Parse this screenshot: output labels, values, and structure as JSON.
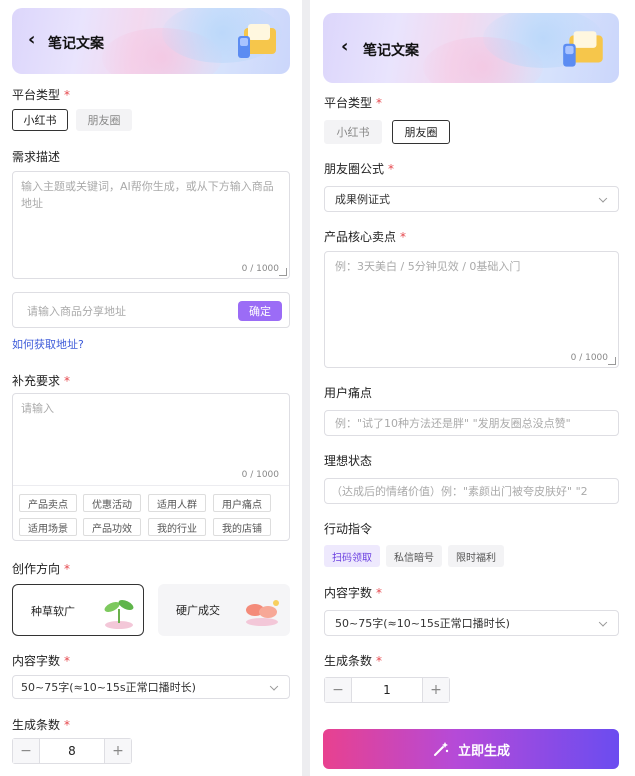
{
  "left": {
    "header": {
      "back_icon": "chevron-left-icon",
      "title": "笔记文案"
    },
    "platform": {
      "label": "平台类型",
      "required": "*",
      "options": [
        "小红书",
        "朋友圈"
      ],
      "selected": "小红书"
    },
    "need": {
      "label": "需求描述",
      "placeholder": "输入主题或关键词，AI帮你生成，或从下方输入商品地址",
      "counter": "0 / 1000"
    },
    "url": {
      "placeholder": "请输入商品分享地址",
      "confirm": "确定",
      "help_link": "如何获取地址?"
    },
    "extra": {
      "label": "补充要求",
      "required": "*",
      "placeholder": "请输入",
      "counter": "0 / 1000",
      "tags": [
        "产品卖点",
        "优惠活动",
        "适用人群",
        "用户痛点",
        "适用场景",
        "产品功效",
        "我的行业",
        "我的店铺"
      ]
    },
    "direction": {
      "label": "创作方向",
      "required": "*",
      "cards": [
        "种草软广",
        "硬广成交"
      ],
      "selected": "种草软广"
    },
    "word_count": {
      "label": "内容字数",
      "required": "*",
      "value": "50~75字(≈10~15s正常口播时长)"
    },
    "gen_count": {
      "label": "生成条数",
      "required": "*",
      "minus": "−",
      "value": "8",
      "plus": "+"
    }
  },
  "right": {
    "header": {
      "back_icon": "chevron-left-icon",
      "title": "笔记文案"
    },
    "platform": {
      "label": "平台类型",
      "required": "*",
      "options": [
        "小红书",
        "朋友圈"
      ],
      "selected": "朋友圈"
    },
    "formula": {
      "label": "朋友圈公式",
      "required": "*",
      "value": "成果例证式"
    },
    "selling": {
      "label": "产品核心卖点",
      "required": "*",
      "placeholder": "例：3天美白 / 5分钟见效 / 0基础入门",
      "counter": "0 / 1000"
    },
    "pain": {
      "label": "用户痛点",
      "placeholder": "例：\"试了10种方法还是胖\" \"发朋友圈总没点赞\""
    },
    "ideal": {
      "label": "理想状态",
      "placeholder": "（达成后的情绪价值）例：\"素颜出门被夸皮肤好\" \"2"
    },
    "action": {
      "label": "行动指令",
      "options": [
        "扫码领取",
        "私信暗号",
        "限时福利"
      ],
      "selected": "扫码领取"
    },
    "word_count": {
      "label": "内容字数",
      "required": "*",
      "value": "50~75字(≈10~15s正常口播时长)"
    },
    "gen_count": {
      "label": "生成条数",
      "required": "*",
      "minus": "−",
      "value": "1",
      "plus": "+"
    },
    "generate": {
      "icon": "magic-wand-icon",
      "label": "立即生成"
    }
  },
  "colors": {
    "accent": "#9b6cf6",
    "required": "#e5484d",
    "link": "#3d5bd9",
    "gen_start": "#e8418f",
    "gen_end": "#6b4cf0"
  }
}
